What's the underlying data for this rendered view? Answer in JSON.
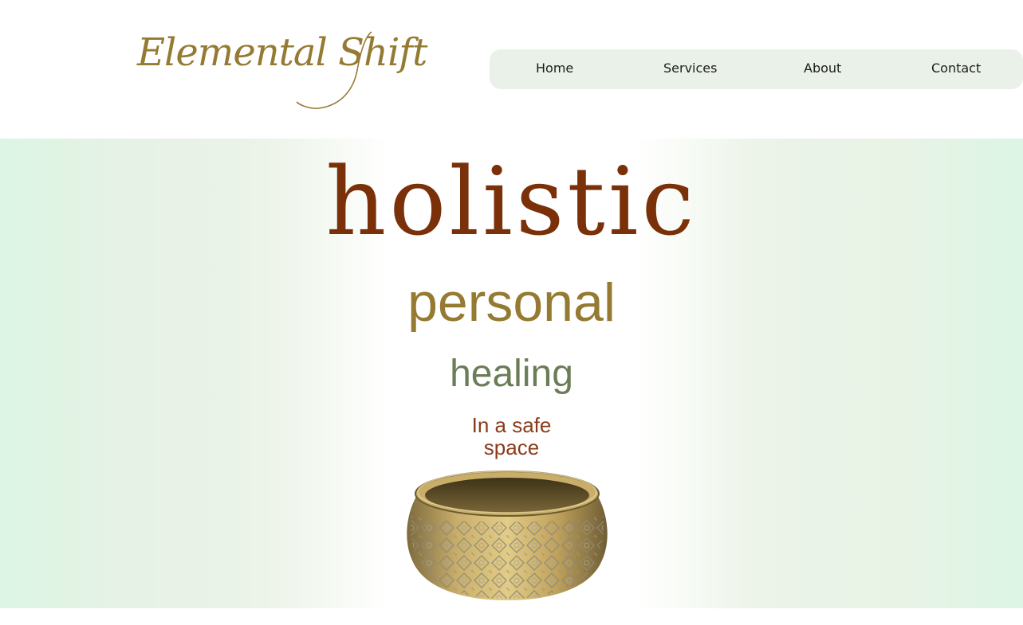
{
  "header": {
    "logo_text": "Elemental Shift",
    "nav": [
      {
        "label": "Home"
      },
      {
        "label": "Services"
      },
      {
        "label": "About"
      },
      {
        "label": "Contact"
      }
    ]
  },
  "hero": {
    "line1": "holistic",
    "line2": "personal",
    "line3": "healing",
    "line4a": "In a safe",
    "line4b": "space",
    "image": "brass-singing-bowl"
  },
  "colors": {
    "logo": "#957a32",
    "nav_bg": "#eaf1e8",
    "holistic": "#7a3008",
    "personal": "#957a32",
    "healing": "#6a7d57",
    "safe_space": "#8a3c1a",
    "hero_edge": "#dcf5e4"
  }
}
